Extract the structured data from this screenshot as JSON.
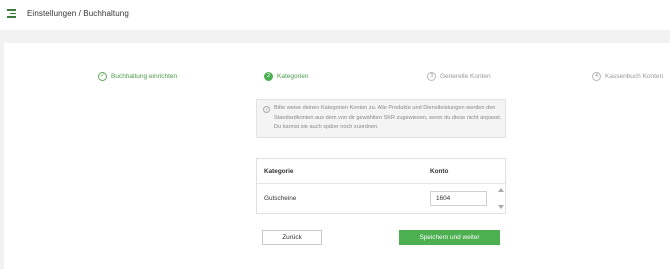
{
  "header": {
    "menu_icon": "hamburger-menu-icon",
    "title": "Einstellungen / Buchhaltung"
  },
  "stepper": {
    "steps": [
      {
        "marker": "✓",
        "label": "Buchhaltung einrichten",
        "state": "done"
      },
      {
        "marker": "2",
        "label": "Kategorien",
        "state": "active"
      },
      {
        "marker": "3",
        "label": "Generelle Konten",
        "state": "todo"
      },
      {
        "marker": "4",
        "label": "Kassenbuch Konten",
        "state": "todo"
      }
    ]
  },
  "info": {
    "icon": "info-icon",
    "text": "Bitte weise deinen Kategorien Konten zu. Alle Produkte und Dienstleistungen werden den Standardkonten aus dem von dir gewählten SKR zugewiesen, wenn du diese nicht anpasst. Du kannst sie auch später noch zuordnen."
  },
  "table": {
    "headers": {
      "category": "Kategorie",
      "account": "Konto"
    },
    "rows": [
      {
        "category": "Gutscheine",
        "account": "1604"
      }
    ]
  },
  "buttons": {
    "back": "Zurück",
    "save": "Speichern und weiter"
  },
  "colors": {
    "accent": "#4caf50",
    "background": "#f2f2f2"
  }
}
